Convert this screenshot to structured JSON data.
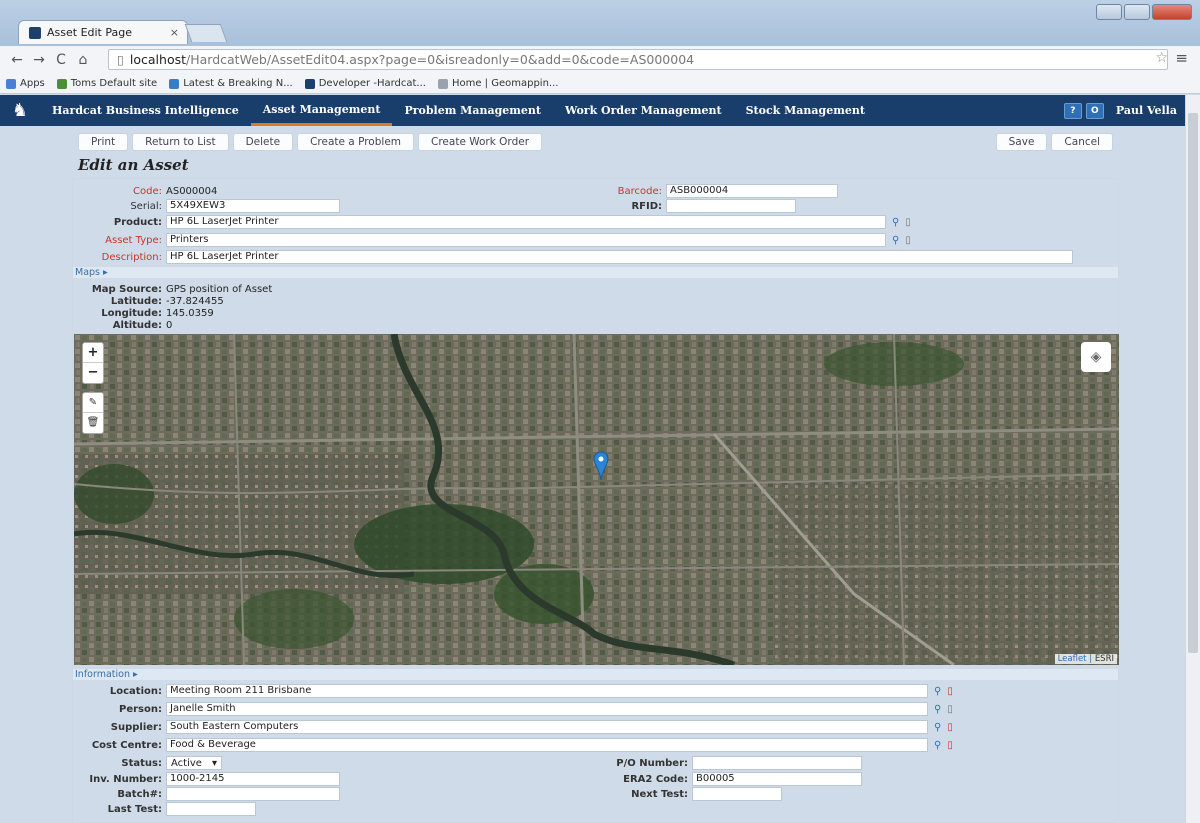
{
  "browser": {
    "tab_title": "Asset Edit Page",
    "url_host": "localhost",
    "url_path": "/HardcatWeb/AssetEdit04.aspx?page=0&isreadonly=0&add=0&code=AS000004",
    "bookmarks": [
      {
        "label": "Apps",
        "color": "#4a7fd6"
      },
      {
        "label": "Toms Default site",
        "color": "#4b8f3a"
      },
      {
        "label": "Latest & Breaking N...",
        "color": "#3b7dc2"
      },
      {
        "label": "Developer -Hardcat...",
        "color": "#1c3f6e"
      },
      {
        "label": "Home | Geomappin...",
        "color": "#9aa3ad"
      }
    ]
  },
  "nav": {
    "items": [
      "Hardcat Business Intelligence",
      "Asset Management",
      "Problem Management",
      "Work Order Management",
      "Stock Management"
    ],
    "active_index": 1,
    "help_label": "?",
    "power_label": "O",
    "user": "Paul Vella"
  },
  "actions": {
    "left": [
      "Print",
      "Return to List",
      "Delete",
      "Create a Problem",
      "Create Work Order"
    ],
    "right": [
      "Save",
      "Cancel"
    ]
  },
  "page_title": "Edit an Asset",
  "asset": {
    "code_label": "Code:",
    "code": "AS000004",
    "serial_label": "Serial:",
    "serial": "5X49XEW3",
    "barcode_label": "Barcode:",
    "barcode": "ASB000004",
    "rfid_label": "RFID:",
    "rfid": "",
    "product_label": "Product:",
    "product": "HP 6L LaserJet Printer",
    "type_label": "Asset Type:",
    "type": "Printers",
    "description_label": "Description:",
    "description": "HP 6L LaserJet Printer"
  },
  "maps": {
    "section_label": "Maps ▸",
    "source_label": "Map Source:",
    "source": "GPS position of Asset",
    "latitude_label": "Latitude:",
    "latitude": "-37.824455",
    "longitude_label": "Longitude:",
    "longitude": "145.0359",
    "altitude_label": "Altitude:",
    "altitude": "0",
    "zoom_in": "+",
    "zoom_out": "−",
    "attribution_link": "Leaflet",
    "attribution_sep": " | ",
    "attribution_tail": "ESRI"
  },
  "information": {
    "section_label": "Information ▸",
    "location_label": "Location:",
    "location": "Meeting Room 211 Brisbane",
    "person_label": "Person:",
    "person": "Janelle Smith",
    "supplier_label": "Supplier:",
    "supplier": "South Eastern Computers",
    "cost_label": "Cost Centre:",
    "cost": "Food & Beverage",
    "status_label": "Status:",
    "status": "Active",
    "inv_label": "Inv. Number:",
    "inv": "1000-2145",
    "batch_label": "Batch#:",
    "batch": "",
    "lasttest_label": "Last Test:",
    "lasttest": "",
    "po_label": "P/O Number:",
    "po": "",
    "era2_label": "ERA2 Code:",
    "era2": "B00005",
    "nexttest_label": "Next Test:",
    "nexttest": ""
  }
}
